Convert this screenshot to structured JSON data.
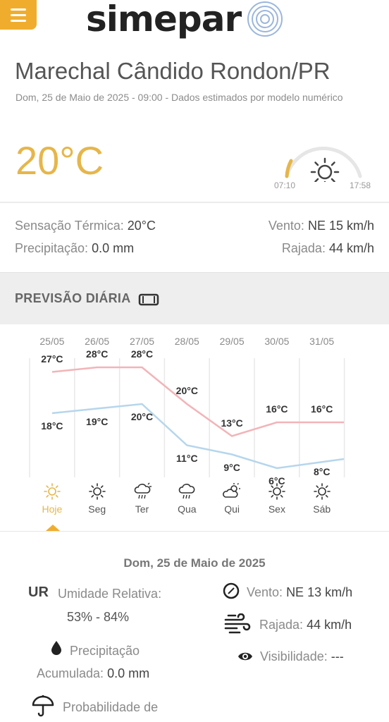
{
  "header": {
    "logo_text": "simepar"
  },
  "location": {
    "city": "Marechal Cândido Rondon/PR",
    "subtitle": "Dom, 25 de Maio de 2025 - 09:00 - Dados estimados por modelo numérico"
  },
  "current": {
    "temperature": "20°C",
    "sunrise": "07:10",
    "sunset": "17:58",
    "feels_like_label": "Sensação Térmica:",
    "feels_like_value": "20°C",
    "precip_label": "Precipitação:",
    "precip_value": "0.0 mm",
    "wind_label": "Vento:",
    "wind_value": "NE 15 km/h",
    "gust_label": "Rajada:",
    "gust_value": "44 km/h"
  },
  "daily_section": {
    "title": "PREVISÃO DIÁRIA"
  },
  "chart_data": {
    "type": "line",
    "categories": [
      "25/05",
      "26/05",
      "27/05",
      "28/05",
      "29/05",
      "30/05",
      "31/05"
    ],
    "day_labels": [
      "Hoje",
      "Seg",
      "Ter",
      "Qua",
      "Qui",
      "Sex",
      "Sáb"
    ],
    "day_icons": [
      "sun-icon",
      "sun-icon",
      "storm-icon",
      "rain-icon",
      "partly-cloudy-icon",
      "sun-icon",
      "sun-icon"
    ],
    "series": [
      {
        "values": [
          27,
          28,
          28,
          20,
          13,
          16,
          16
        ],
        "color": "#f2b4b8"
      },
      {
        "values": [
          18,
          19,
          20,
          11,
          9,
          6,
          8
        ],
        "color": "#b6d6ec"
      }
    ],
    "max_labels": [
      "27°C",
      "28°C",
      "28°C",
      "20°C",
      "13°C",
      "16°C",
      "16°C"
    ],
    "min_labels": [
      "18°C",
      "19°C",
      "20°C",
      "11°C",
      "9°C",
      "6°C",
      "8°C"
    ],
    "ylim": [
      4,
      30
    ]
  },
  "detail": {
    "date": "Dom, 25 de Maio de 2025",
    "ur_abbr": "UR",
    "ur_label": "Umidade Relativa:",
    "ur_value": "53% - 84%",
    "precip_label_1": "Precipitação",
    "precip_label_2": "Acumulada:",
    "precip_value": "0.0 mm",
    "prob_label": "Probabilidade de",
    "wind_label": "Vento:",
    "wind_value": "NE 13 km/h",
    "gust_label": "Rajada:",
    "gust_value": "44 km/h",
    "vis_label": "Visibilidade:",
    "vis_value": "---"
  },
  "colors": {
    "accent": "#f0ad2d",
    "temp": "#e6b64a",
    "max_line": "#f2b4b8",
    "min_line": "#b6d6ec"
  }
}
